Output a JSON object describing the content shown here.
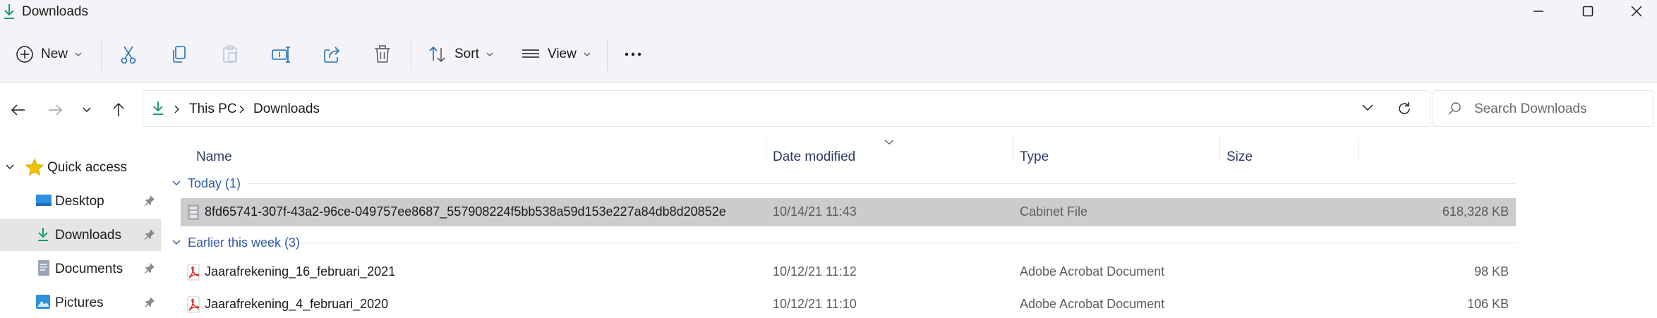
{
  "window": {
    "title": "Downloads"
  },
  "toolbar": {
    "new_label": "New",
    "sort_label": "Sort",
    "view_label": "View"
  },
  "address": {
    "this_pc": "This PC",
    "current": "Downloads",
    "search_placeholder": "Search Downloads"
  },
  "sidebar": {
    "quick_access": "Quick access",
    "items": [
      {
        "label": "Desktop",
        "icon": "desktop-icon",
        "pinned": true
      },
      {
        "label": "Downloads",
        "icon": "downloads-icon",
        "pinned": true,
        "selected": true
      },
      {
        "label": "Documents",
        "icon": "documents-icon",
        "pinned": true
      },
      {
        "label": "Pictures",
        "icon": "pictures-icon",
        "pinned": true
      }
    ]
  },
  "columns": {
    "name": "Name",
    "date": "Date modified",
    "type": "Type",
    "size": "Size"
  },
  "groups": [
    {
      "label": "Today (1)",
      "files": [
        {
          "name": "8fd65741-307f-43a2-96ce-049757ee8687_557908224f5bb538a59d153e227a84db8d20852e",
          "date": "10/14/21 11:43",
          "type": "Cabinet File",
          "size": "618,328 KB",
          "icon": "cabinet-file-icon",
          "selected": true
        }
      ]
    },
    {
      "label": "Earlier this week (3)",
      "files": [
        {
          "name": "Jaarafrekening_16_februari_2021",
          "date": "10/12/21 11:12",
          "type": "Adobe Acrobat Document",
          "size": "98 KB",
          "icon": "pdf-icon"
        },
        {
          "name": "Jaarafrekening_4_februari_2020",
          "date": "10/12/21 11:10",
          "type": "Adobe Acrobat Document",
          "size": "106 KB",
          "icon": "pdf-icon"
        }
      ]
    }
  ],
  "colors": {
    "accent": "#0067c0",
    "selection": "#cccccc",
    "group_header": "#2e5aa8",
    "chrome": "#f3f3f8"
  }
}
